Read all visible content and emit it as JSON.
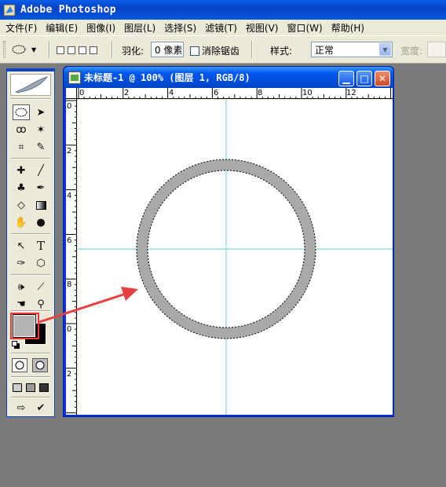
{
  "app": {
    "title": "Adobe Photoshop"
  },
  "menu": [
    "文件(F)",
    "编辑(E)",
    "图像(I)",
    "图层(L)",
    "选择(S)",
    "滤镜(T)",
    "视图(V)",
    "窗口(W)",
    "帮助(H)"
  ],
  "options": {
    "feather_label": "羽化:",
    "feather_value": "0 像素",
    "antialias_label": "消除锯齿",
    "style_label": "样式:",
    "style_value": "正常",
    "width_label": "宽度:"
  },
  "document": {
    "title": "未标题-1 @ 100% (图层 1, RGB/8)",
    "ruler_top_labels": [
      "0",
      "2",
      "4",
      "6",
      "8",
      "10",
      "12"
    ],
    "ruler_left_labels": [
      "0",
      "2",
      "4",
      "6",
      "8",
      "0",
      "2"
    ]
  },
  "colors": {
    "foreground": "#b4b4b4",
    "background": "#000000",
    "ring": "#a9a9a9",
    "guide": "#5ad6e0",
    "annotation_arrow": "#e84040"
  },
  "icons": [
    "ps-icon",
    "marquee-icon",
    "move-icon",
    "lasso-icon",
    "magic-wand-icon",
    "crop-icon",
    "slice-icon",
    "healing-icon",
    "brush-icon",
    "stamp-icon",
    "history-brush-icon",
    "eraser-icon",
    "gradient-icon",
    "blur-icon",
    "dodge-icon",
    "path-select-icon",
    "type-icon",
    "pen-icon",
    "shape-icon",
    "notes-icon",
    "eyedropper-icon",
    "hand-icon",
    "zoom-icon"
  ]
}
